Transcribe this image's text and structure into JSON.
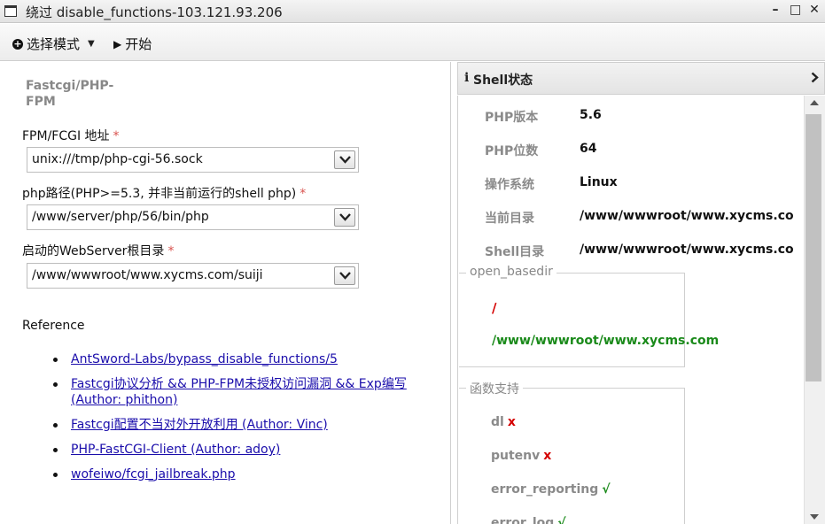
{
  "window": {
    "title": "绕过 disable_functions-103.121.93.206",
    "minimize": "–",
    "maximize": "□",
    "close": "✕"
  },
  "toolbar": {
    "mode_label": "选择模式",
    "start_label": "开始"
  },
  "left": {
    "section_title": "Fastcgi/PHP-FPM",
    "fields": [
      {
        "label": "FPM/FCGI 地址",
        "required": "*",
        "value": "unix:///tmp/php-cgi-56.sock"
      },
      {
        "label": "php路径(PHP>=5.3, 并非当前运行的shell php)",
        "required": "*",
        "value": "/www/server/php/56/bin/php"
      },
      {
        "label": "启动的WebServer根目录",
        "required": "*",
        "value": "/www/wwwroot/www.xycms.com/suiji"
      }
    ],
    "reference_title": "Reference",
    "references": [
      "AntSword-Labs/bypass_disable_functions/5",
      "Fastcgi协议分析 && PHP-FPM未授权访问漏洞 && Exp编写 (Author: phithon)",
      "Fastcgi配置不当对外开放利用 (Author: Vinc)",
      "PHP-FastCGI-Client (Author: adoy)",
      "wofeiwo/fcgi_jailbreak.php"
    ]
  },
  "right": {
    "header_icon": "info-icon",
    "header_title": "Shell状态",
    "status": [
      {
        "key": "PHP版本",
        "value": "5.6"
      },
      {
        "key": "PHP位数",
        "value": "64"
      },
      {
        "key": "操作系统",
        "value": "Linux"
      },
      {
        "key": "当前目录",
        "value": "/www/wwwroot/www.xycms.co"
      },
      {
        "key": "Shell目录",
        "value": "/www/wwwroot/www.xycms.co"
      }
    ],
    "open_basedir_legend": "open_basedir",
    "open_basedir": [
      "/",
      "/www/wwwroot/www.xycms.com"
    ],
    "functions_legend": "函数支持",
    "functions": [
      {
        "name": "dl",
        "mark": "x",
        "supported": false
      },
      {
        "name": "putenv",
        "mark": "x",
        "supported": false
      },
      {
        "name": "error_reporting",
        "mark": "√",
        "supported": true
      },
      {
        "name": "error_log",
        "mark": "√",
        "supported": true
      }
    ]
  },
  "colors": {
    "required": "#d9534f",
    "link": "#1a0dab",
    "unsupported": "#d40000",
    "supported": "#1a8a1a"
  }
}
